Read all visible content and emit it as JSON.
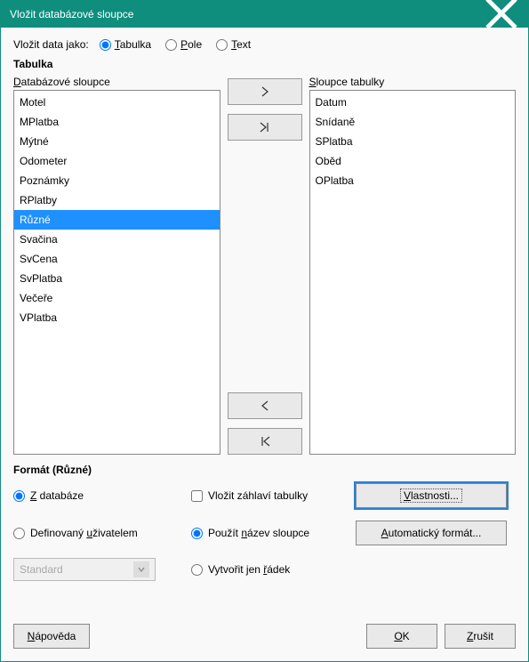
{
  "window": {
    "title": "Vložit databázové sloupce"
  },
  "insert_label": "Vložit data jako:",
  "radios_insert": {
    "table": "abulka",
    "table_u": "T",
    "fields": "ole",
    "fields_u": "P",
    "text": "ext",
    "text_u": "T"
  },
  "section_table_label": "Tabulka",
  "db_cols_label": "atabázové sloupce",
  "db_cols_u": "D",
  "table_cols_label": "loupce tabulky",
  "table_cols_u": "S",
  "db_columns": [
    "Motel",
    "MPlatba",
    "Mýtné",
    "Odometer",
    "Poznámky",
    "RPlatby",
    "Různé",
    "Svačina",
    "SvCena",
    "SvPlatba",
    "Večeře",
    "VPlatba"
  ],
  "db_selected_index": 6,
  "table_columns": [
    "Datum",
    "Snídaně",
    "SPlatba",
    "Oběd",
    "OPlatba"
  ],
  "format_section": "Formát (Různé)",
  "format": {
    "from_db_label": " databáze",
    "from_db_u": "Z",
    "userdef_label": "živatelem",
    "userdef_pre": "Definovaný ",
    "userdef_u": "u",
    "insert_head_label": "áhlaví tabulky",
    "insert_head_pre": "Vložit z",
    "insert_head_u": "",
    "use_colname_label": "ázev sloupce",
    "use_colname_pre": "Použít ",
    "use_colname_u": "n",
    "create_row_label": "ádek",
    "create_row_pre": "Vytvořit jen ",
    "create_row_u": "ř",
    "properties_label": "lastnosti...",
    "properties_u": "V",
    "autoformat_label": "utomatický formát...",
    "autoformat_u": "A",
    "select_value": "Standard"
  },
  "buttons": {
    "help": "ápověda",
    "help_u": "N",
    "ok": "K",
    "ok_u": "O",
    "cancel": "rušit",
    "cancel_u": "Z"
  }
}
